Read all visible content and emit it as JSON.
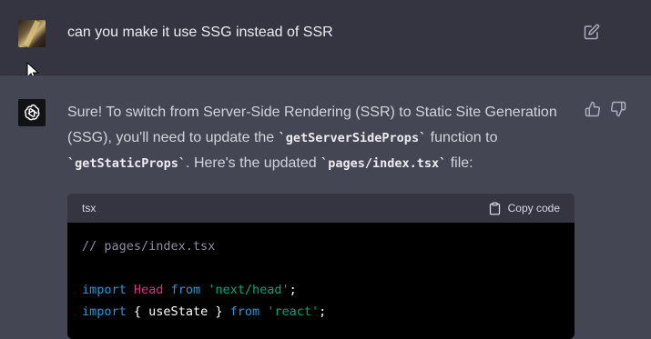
{
  "user_message": {
    "text": "can you make it use SSG instead of SSR"
  },
  "assistant_message": {
    "line1_pre": "Sure! To switch from Server-Side Rendering (SSR) to Static Site Generation",
    "line2_pre": "(SSG), you'll need to update the ",
    "code_a": "`getServerSideProps`",
    "line2_post": " function to",
    "code_b": "`getStaticProps`",
    "line3_mid": ". Here's the updated ",
    "code_c": "`pages/index.tsx`",
    "line3_post": " file:"
  },
  "code_block": {
    "language": "tsx",
    "copy_label": "Copy code",
    "comment": "// pages/index.tsx",
    "line2_kw": "import",
    "line2_name": "Head",
    "line2_from": "from",
    "line2_str": "'next/head'",
    "line3_kw": "import",
    "line3_mid": "{ useState }",
    "line3_from": "from",
    "line3_str": "'react'"
  },
  "icons": [
    "user-avatar",
    "edit-icon",
    "chatgpt-logo-icon",
    "thumbs-up-icon",
    "thumbs-down-icon",
    "clipboard-icon",
    "mouse-cursor"
  ],
  "colors": {
    "user_bg": "#343541",
    "assistant_bg": "#444654",
    "code_bg": "#000000",
    "keyword": "#2e95d3",
    "string": "#00a67d",
    "identifier": "#df3079"
  }
}
